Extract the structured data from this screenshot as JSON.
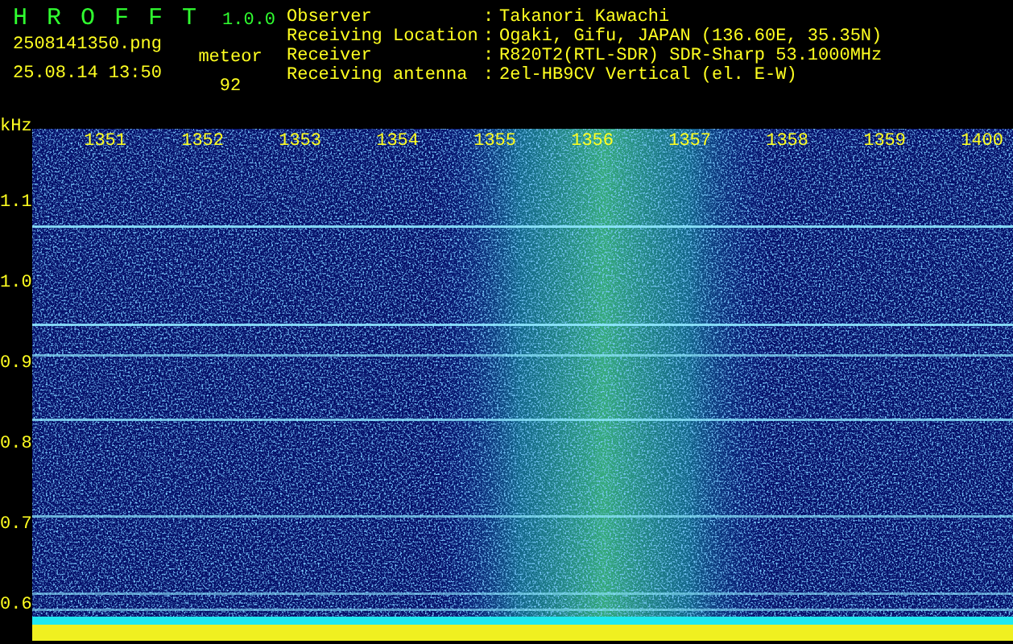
{
  "app": {
    "name": "HROFFT",
    "version": "1.0.0"
  },
  "file": "2508141350.png",
  "datetime": "25.08.14 13:50",
  "count_label": "meteor",
  "count": "92",
  "info": [
    {
      "label": "Observer",
      "sep": ":",
      "value": "Takanori Kawachi"
    },
    {
      "label": "Receiving Location",
      "sep": ":",
      "value": "Ogaki, Gifu, JAPAN (136.60E, 35.35N)"
    },
    {
      "label": "Receiver",
      "sep": ":",
      "value": "R820T2(RTL-SDR) SDR-Sharp 53.1000MHz"
    },
    {
      "label": "Receiving antenna",
      "sep": ":",
      "value": "2el-HB9CV Vertical (el. E-W)"
    }
  ],
  "spectrogram": {
    "y_unit": "kHz",
    "x_labels": [
      "1351",
      "1352",
      "1353",
      "1354",
      "1355",
      "1356",
      "1357",
      "1358",
      "1359",
      "1400"
    ],
    "y_labels": [
      "1.1",
      "1.0",
      "0.9",
      "0.8",
      "0.7",
      "0.6"
    ]
  }
}
